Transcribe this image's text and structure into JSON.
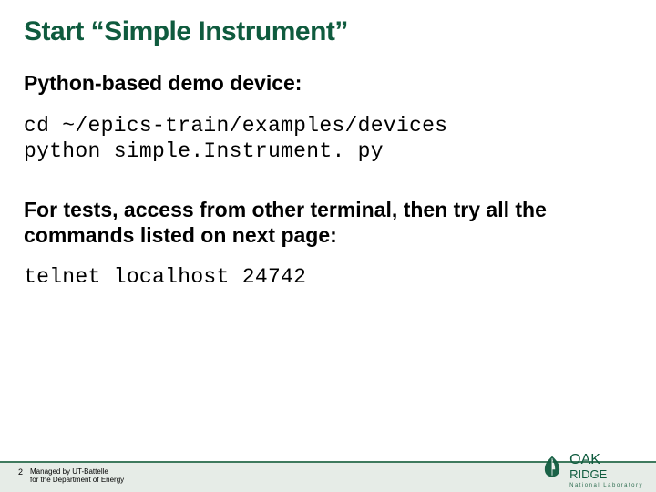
{
  "title": "Start “Simple Instrument”",
  "intro": "Python-based demo device:",
  "code1": "cd ~/epics-train/examples/devices\npython simple.Instrument. py",
  "para2": "For tests, access from other terminal, then try all the commands listed on next page:",
  "code2": "telnet localhost 24742",
  "footer": {
    "page_number": "2",
    "managed_line1": "Managed by UT-Battelle",
    "managed_line2": "for the Department of Energy",
    "logo_main": "OAK",
    "logo_sub1": "RIDGE",
    "logo_sub2": "National Laboratory"
  }
}
